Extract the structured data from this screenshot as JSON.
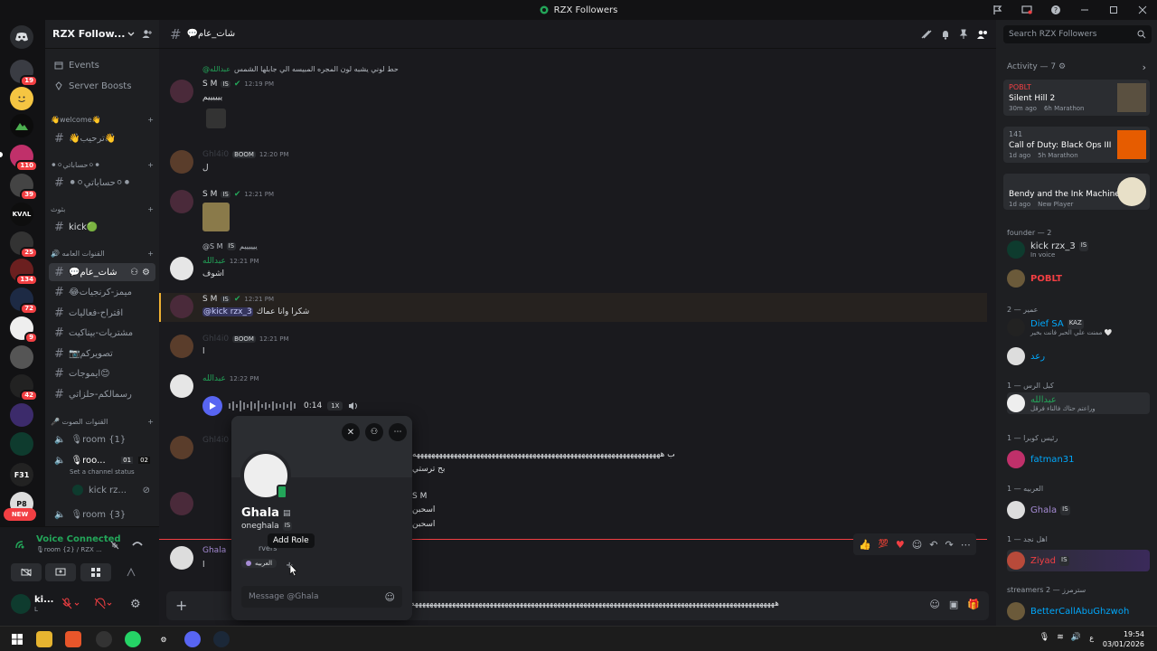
{
  "window": {
    "title": "RZX Followers"
  },
  "server": {
    "name": "RZX Follow..."
  },
  "rail": {
    "badges": [
      "19",
      "110",
      "39",
      "25",
      "134",
      "72",
      "9",
      "42"
    ],
    "new_label": "NEW",
    "server_initials": {
      "kvl": "KVΛL",
      "f31": "F31",
      "pb": "P8"
    }
  },
  "sidebar": {
    "top_items": [
      "Events",
      "Server Boosts"
    ],
    "categories": {
      "welcome": "👋welcome👋",
      "accounts": "⚫⚪حساباتي⚪⚫",
      "kick": "بثوث",
      "public": "🔊 القنوات العامه",
      "voice": "🎤 القنوات الصوت"
    },
    "channels": {
      "welcome_ch": "👋ترحيب👋",
      "accounts_ch": "⚫⚪حساباتي⚪⚫",
      "kick_ch": "kick🟢",
      "chat": "💬شات_عام",
      "memes": "😂ميمز-كرنجيات",
      "suggest": "اقتراح-فعاليات",
      "shares": "مشتريات-بيناكيت",
      "photos": "📷تصويركم",
      "emotes": "ايموجات😊",
      "talk": "رسمالكم-حلزاتي"
    },
    "voice_channels": {
      "room1": "🎙room {1}",
      "room2": "🎙roo...",
      "room2_count_a": "01",
      "room2_count_b": "02",
      "status_hint": "Set a channel status",
      "room2_member": "kick rz...",
      "room3": "🎙room {3}"
    }
  },
  "voice_panel": {
    "status": "Voice Connected",
    "where": "🎙room {2} / RZX ...",
    "user": "ki...",
    "user_sub": "L"
  },
  "chat": {
    "channel_name": "💬شات_عام",
    "messages": {
      "reply1_author": "@عبدالله",
      "reply1_text": "حط لوني يشبه لون المجره المبيسه الي جابلها الشمس",
      "m1_author": "S M",
      "m1_tag": "IS",
      "m1_time": "12:19 PM",
      "m1_text": "ييييييم",
      "m2_author": "Ghl4i0",
      "m2_tag": "BOOM",
      "m2_time": "12:20 PM",
      "m2_text": "ل",
      "m3_author": "S M",
      "m3_tag": "IS",
      "m3_time": "12:21 PM",
      "reply2_author": "@S M",
      "reply2_tag": "IS",
      "reply2_text": "ييييييم",
      "m4_author": "عبدالله",
      "m4_time": "12:21 PM",
      "m4_text": "اشوف",
      "m5_author": "S M",
      "m5_tag": "IS",
      "m5_time": "12:21 PM",
      "m5_mention": "@kick rzx_3",
      "m5_text": "شكرا وانا عماك",
      "m6_author": "Ghl4i0",
      "m6_tag": "BOOM",
      "m6_time": "12:21 PM",
      "m6_text": "ا",
      "m7_author": "عبدالله",
      "m7_time": "12:22 PM",
      "voice_duration": "0:14",
      "voice_speed": "1X",
      "m8_author": "Ghl4i0",
      "m8_text": "ماقلت عير لوني طيب ههههههههههههههههههههههههههههههههههههههههههههههههههههههههههههههههههه",
      "m8_line2": "بح ترستي",
      "m9_author": "S M",
      "m9_text": "اسحبن",
      "m9_line2": "اسحبن",
      "m10_author": "Ghala",
      "m10_text": "ا"
    },
    "input_placeholder": "هههههههههههههههههههههههههههههههههههههههههههههههههههههههههههههههههههههههههههههههههههههههههههههههههه"
  },
  "popout": {
    "display_name": "Ghala",
    "username": "oneghala",
    "tag": "IS",
    "tooltip": "Add Role",
    "servers_text": "rvers",
    "role": "العربيه",
    "message_placeholder": "Message @Ghala"
  },
  "members": {
    "search_placeholder": "Search RZX Followers",
    "activity_header": "Activity — 7",
    "activities": [
      {
        "user": "POBLT",
        "game": "Silent Hill 2",
        "when": "30m ago",
        "detail": "6h Marathon"
      },
      {
        "user": "141",
        "game": "Call of Duty: Black Ops III",
        "when": "1d ago",
        "detail": "5h Marathon"
      },
      {
        "user": "",
        "game": "Bendy and the Ink Machine",
        "when": "1d ago",
        "detail": "New Player"
      }
    ],
    "groups": {
      "founder": "founder — 2",
      "group2": "عمير — 2",
      "group3": "كبل الرس — 1",
      "group4": "رئيس كوبرا — 1",
      "group5": "العربيه — 1",
      "group6": "اهل نجد — 1",
      "streamers": "streamers 2 — سترمرز"
    },
    "list": {
      "kick": "kick rzx_3",
      "kick_tag": "IS",
      "kick_sub": "In voice",
      "poblt": "POBLT",
      "dief": "Dief SA",
      "dief_tag": "KAZ",
      "dief_sub": "ممنت علي الحبر فانت بخير 🤍",
      "raad": "رعد",
      "abdullah": "عبدالله",
      "abdullah_sub": "وراعتم حتاك فالناء فرقل",
      "fatman": "fatman31",
      "ghala": "Ghala",
      "ghala_tag": "IS",
      "ziyad": "Ziyad",
      "ziyad_tag": "IS",
      "better": "BetterCallAbuGhzwoh"
    }
  },
  "taskbar": {
    "time": "19:54",
    "date": "03/01/2026",
    "lang": "ع"
  },
  "colors": {
    "accent": "#5865f2",
    "green": "#23a559",
    "red": "#f23f43",
    "link": "#00a8fc"
  }
}
